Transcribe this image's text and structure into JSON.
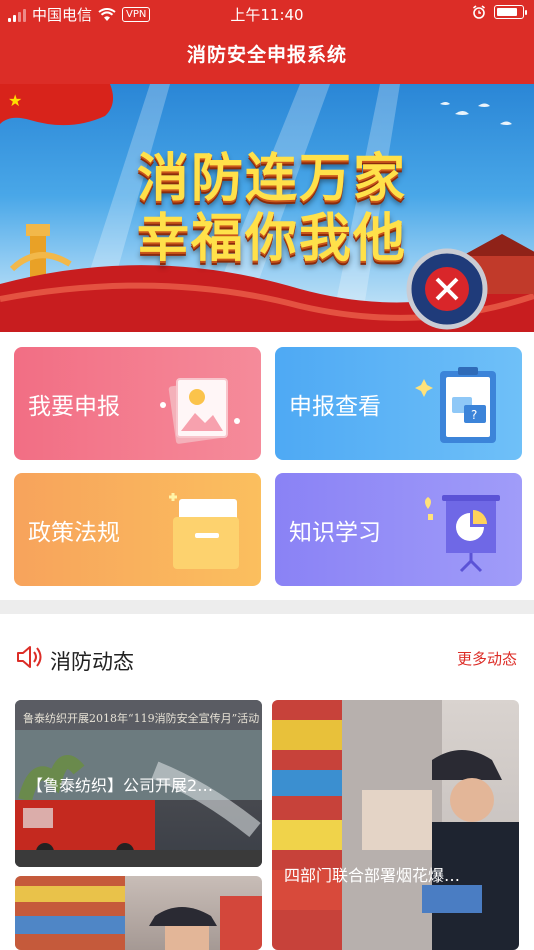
{
  "status_bar": {
    "carrier": "中国电信",
    "vpn": "VPN",
    "time": "上午11:40",
    "battery_level": 0.85
  },
  "header": {
    "title": "消防安全申报系统"
  },
  "banner": {
    "line1": "消防连万家",
    "line2": "幸福你我他"
  },
  "menu": {
    "report": "我要申报",
    "view": "申报查看",
    "policy": "政策法规",
    "learn": "知识学习"
  },
  "news": {
    "title": "消防动态",
    "more": "更多动态",
    "items": [
      {
        "caption": "【鲁泰纺织】公司开展2…",
        "image_text": "鲁泰纺织开展2018年“119消防安全宣传月”活动"
      },
      {
        "caption": "四部门联合部署烟花爆…"
      }
    ]
  },
  "colors": {
    "brand_red": "#dc2d27",
    "card_report": "#f26e84",
    "card_view": "#4ea9f4",
    "card_policy": "#f7a35c",
    "card_learn": "#8a82f5"
  }
}
